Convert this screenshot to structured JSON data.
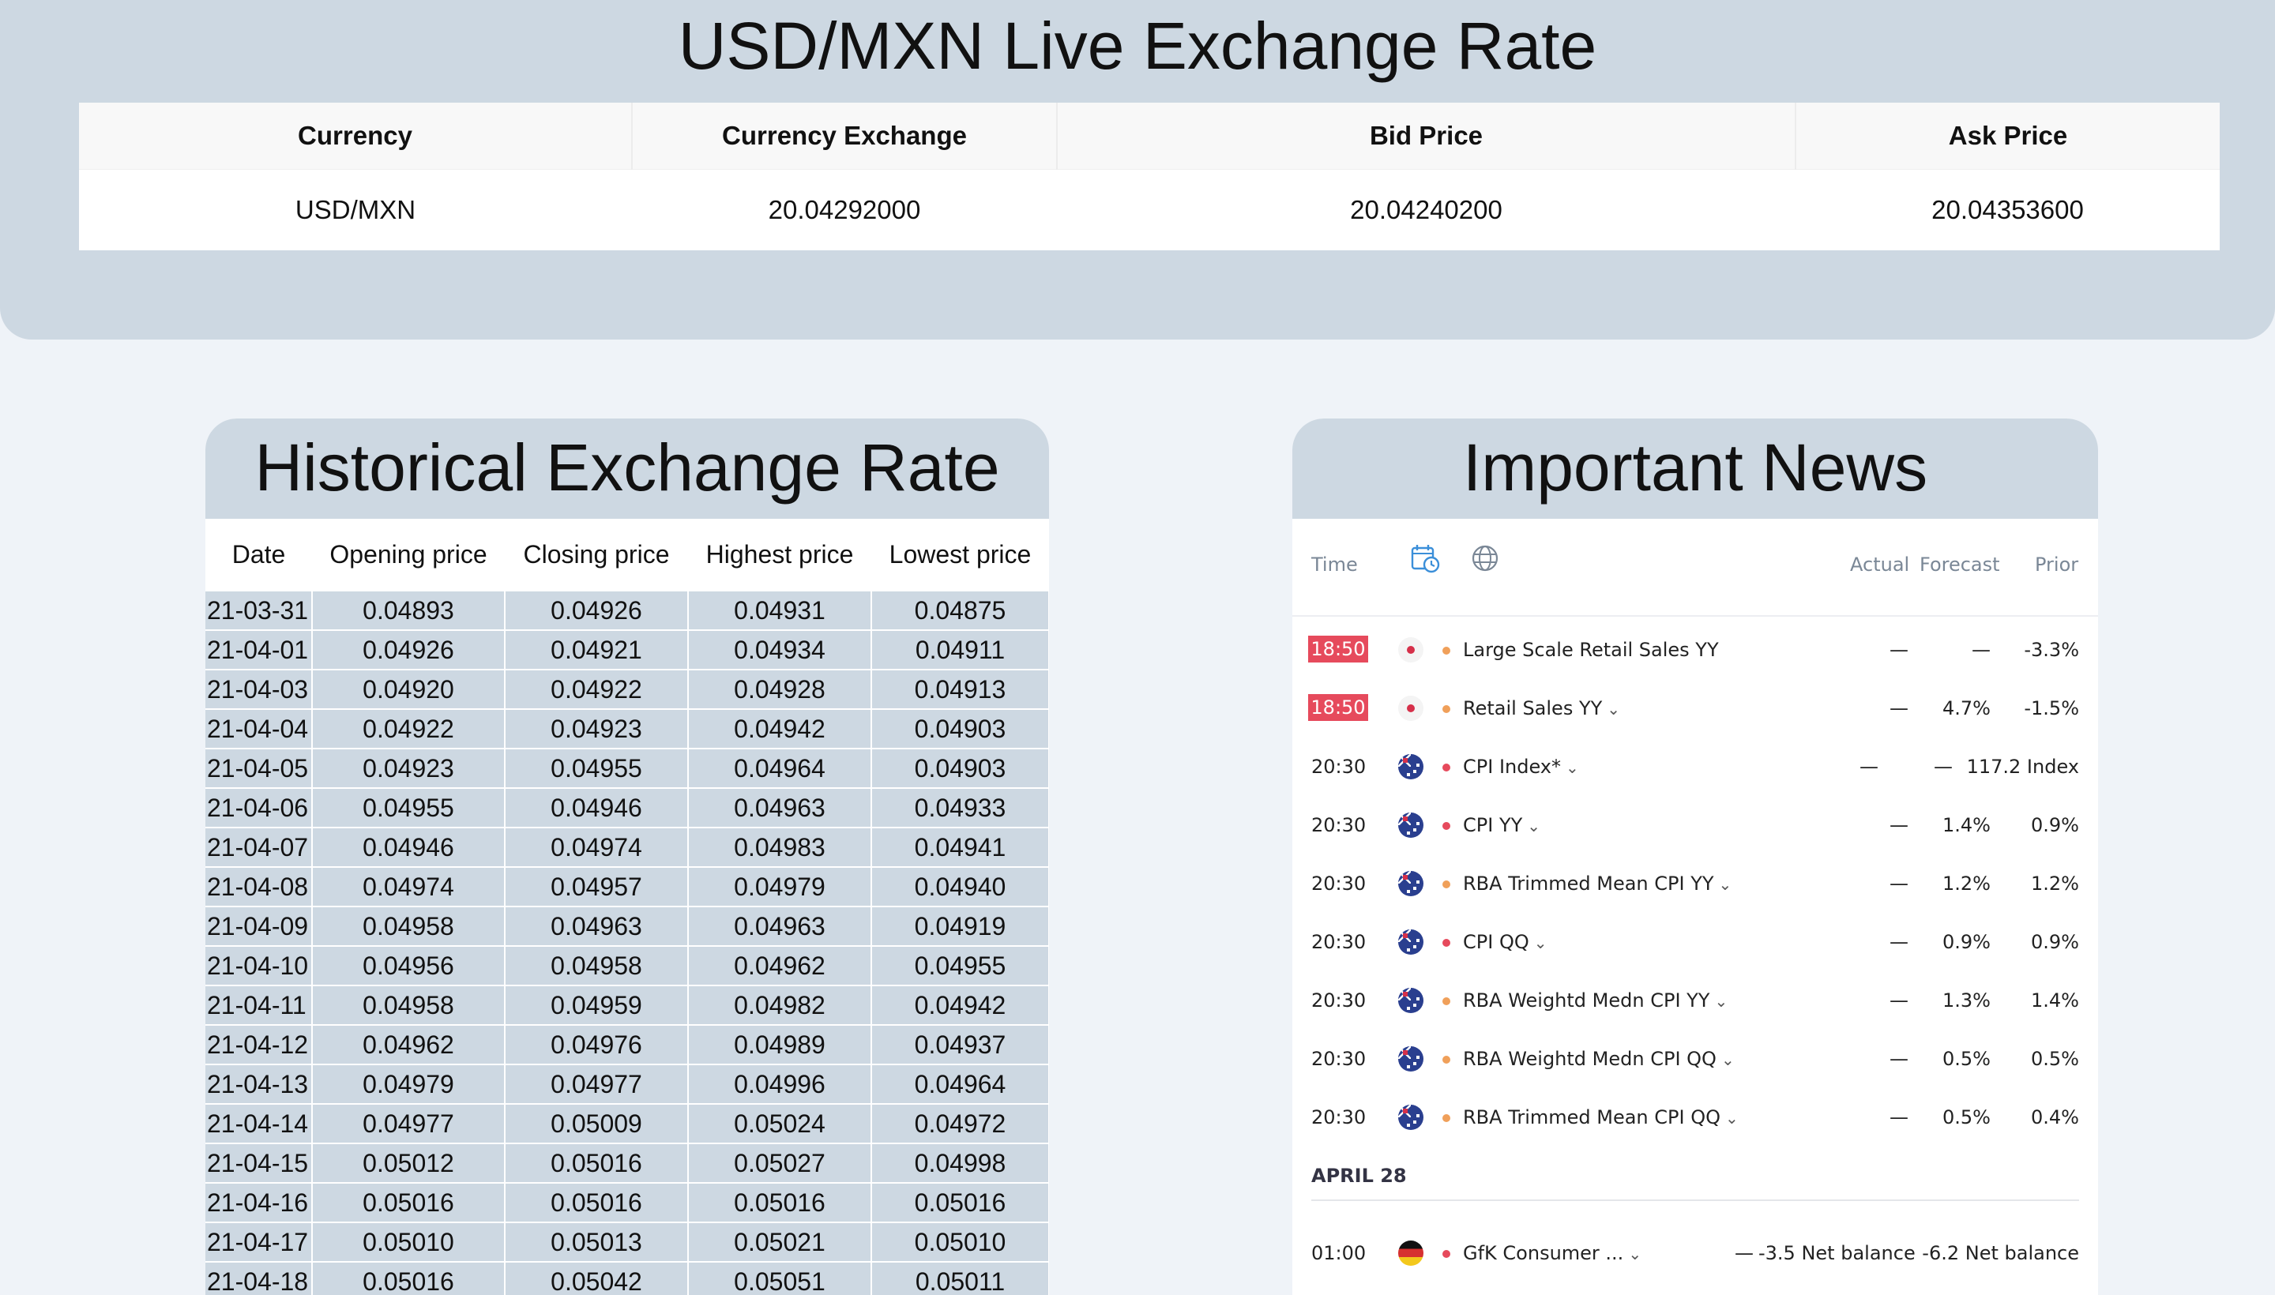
{
  "live": {
    "title": "USD/MXN Live Exchange Rate",
    "headers": [
      "Currency",
      "Currency Exchange",
      "Bid Price",
      "Ask Price"
    ],
    "row": [
      "USD/MXN",
      "20.04292000",
      "20.04240200",
      "20.04353600"
    ]
  },
  "historical": {
    "title": "Historical Exchange Rate",
    "headers": [
      "Date",
      "Opening price",
      "Closing price",
      "Highest price",
      "Lowest price"
    ],
    "rows": [
      [
        "21-03-31",
        "0.04893",
        "0.04926",
        "0.04931",
        "0.04875"
      ],
      [
        "21-04-01",
        "0.04926",
        "0.04921",
        "0.04934",
        "0.04911"
      ],
      [
        "21-04-03",
        "0.04920",
        "0.04922",
        "0.04928",
        "0.04913"
      ],
      [
        "21-04-04",
        "0.04922",
        "0.04923",
        "0.04942",
        "0.04903"
      ],
      [
        "21-04-05",
        "0.04923",
        "0.04955",
        "0.04964",
        "0.04903"
      ],
      [
        "21-04-06",
        "0.04955",
        "0.04946",
        "0.04963",
        "0.04933"
      ],
      [
        "21-04-07",
        "0.04946",
        "0.04974",
        "0.04983",
        "0.04941"
      ],
      [
        "21-04-08",
        "0.04974",
        "0.04957",
        "0.04979",
        "0.04940"
      ],
      [
        "21-04-09",
        "0.04958",
        "0.04963",
        "0.04963",
        "0.04919"
      ],
      [
        "21-04-10",
        "0.04956",
        "0.04958",
        "0.04962",
        "0.04955"
      ],
      [
        "21-04-11",
        "0.04958",
        "0.04959",
        "0.04982",
        "0.04942"
      ],
      [
        "21-04-12",
        "0.04962",
        "0.04976",
        "0.04989",
        "0.04937"
      ],
      [
        "21-04-13",
        "0.04979",
        "0.04977",
        "0.04996",
        "0.04964"
      ],
      [
        "21-04-14",
        "0.04977",
        "0.05009",
        "0.05024",
        "0.04972"
      ],
      [
        "21-04-15",
        "0.05012",
        "0.05016",
        "0.05027",
        "0.04998"
      ],
      [
        "21-04-16",
        "0.05016",
        "0.05016",
        "0.05016",
        "0.05016"
      ],
      [
        "21-04-17",
        "0.05010",
        "0.05013",
        "0.05021",
        "0.05010"
      ],
      [
        "21-04-18",
        "0.05016",
        "0.05042",
        "0.05051",
        "0.05011"
      ]
    ]
  },
  "news": {
    "title": "Important News",
    "col_time": "Time",
    "col_actual": "Actual",
    "col_forecast": "Forecast",
    "col_prior": "Prior",
    "icons": {
      "calendar": "calendar-clock-icon",
      "globe": "globe-icon"
    },
    "colors": {
      "badge": "#e64a5c",
      "high": "#e64a5c",
      "medium": "#f0a05a"
    },
    "events": [
      {
        "time": "18:50",
        "highlight": true,
        "flag": "jp",
        "importance": "medium",
        "name": "Large Scale Retail Sales YY",
        "chevron": false,
        "actual": "—",
        "forecast": "—",
        "prior": "-3.3%"
      },
      {
        "time": "18:50",
        "highlight": true,
        "flag": "jp",
        "importance": "medium",
        "name": "Retail Sales YY",
        "chevron": true,
        "actual": "—",
        "forecast": "4.7%",
        "prior": "-1.5%"
      },
      {
        "time": "20:30",
        "highlight": false,
        "flag": "au",
        "importance": "high",
        "name": "CPI Index*",
        "chevron": true,
        "actual": "—",
        "forecast": "—",
        "prior": "117.2 Index"
      },
      {
        "time": "20:30",
        "highlight": false,
        "flag": "au",
        "importance": "high",
        "name": "CPI YY",
        "chevron": true,
        "actual": "—",
        "forecast": "1.4%",
        "prior": "0.9%"
      },
      {
        "time": "20:30",
        "highlight": false,
        "flag": "au",
        "importance": "medium",
        "name": "RBA Trimmed Mean CPI YY",
        "chevron": true,
        "actual": "—",
        "forecast": "1.2%",
        "prior": "1.2%"
      },
      {
        "time": "20:30",
        "highlight": false,
        "flag": "au",
        "importance": "high",
        "name": "CPI QQ",
        "chevron": true,
        "actual": "—",
        "forecast": "0.9%",
        "prior": "0.9%"
      },
      {
        "time": "20:30",
        "highlight": false,
        "flag": "au",
        "importance": "medium",
        "name": "RBA Weightd Medn CPI YY",
        "chevron": true,
        "actual": "—",
        "forecast": "1.3%",
        "prior": "1.4%"
      },
      {
        "time": "20:30",
        "highlight": false,
        "flag": "au",
        "importance": "medium",
        "name": "RBA Weightd Medn CPI QQ",
        "chevron": true,
        "actual": "—",
        "forecast": "0.5%",
        "prior": "0.5%"
      },
      {
        "time": "20:30",
        "highlight": false,
        "flag": "au",
        "importance": "medium",
        "name": "RBA Trimmed Mean CPI QQ",
        "chevron": true,
        "actual": "—",
        "forecast": "0.5%",
        "prior": "0.4%"
      }
    ],
    "date_label": "APRIL 28",
    "events2": [
      {
        "time": "01:00",
        "highlight": false,
        "flag": "de",
        "importance": "high",
        "name": "GfK Consumer ...",
        "chevron": true,
        "actual": "—",
        "forecast": "-3.5 Net balance",
        "prior": "-6.2 Net balance"
      }
    ]
  }
}
